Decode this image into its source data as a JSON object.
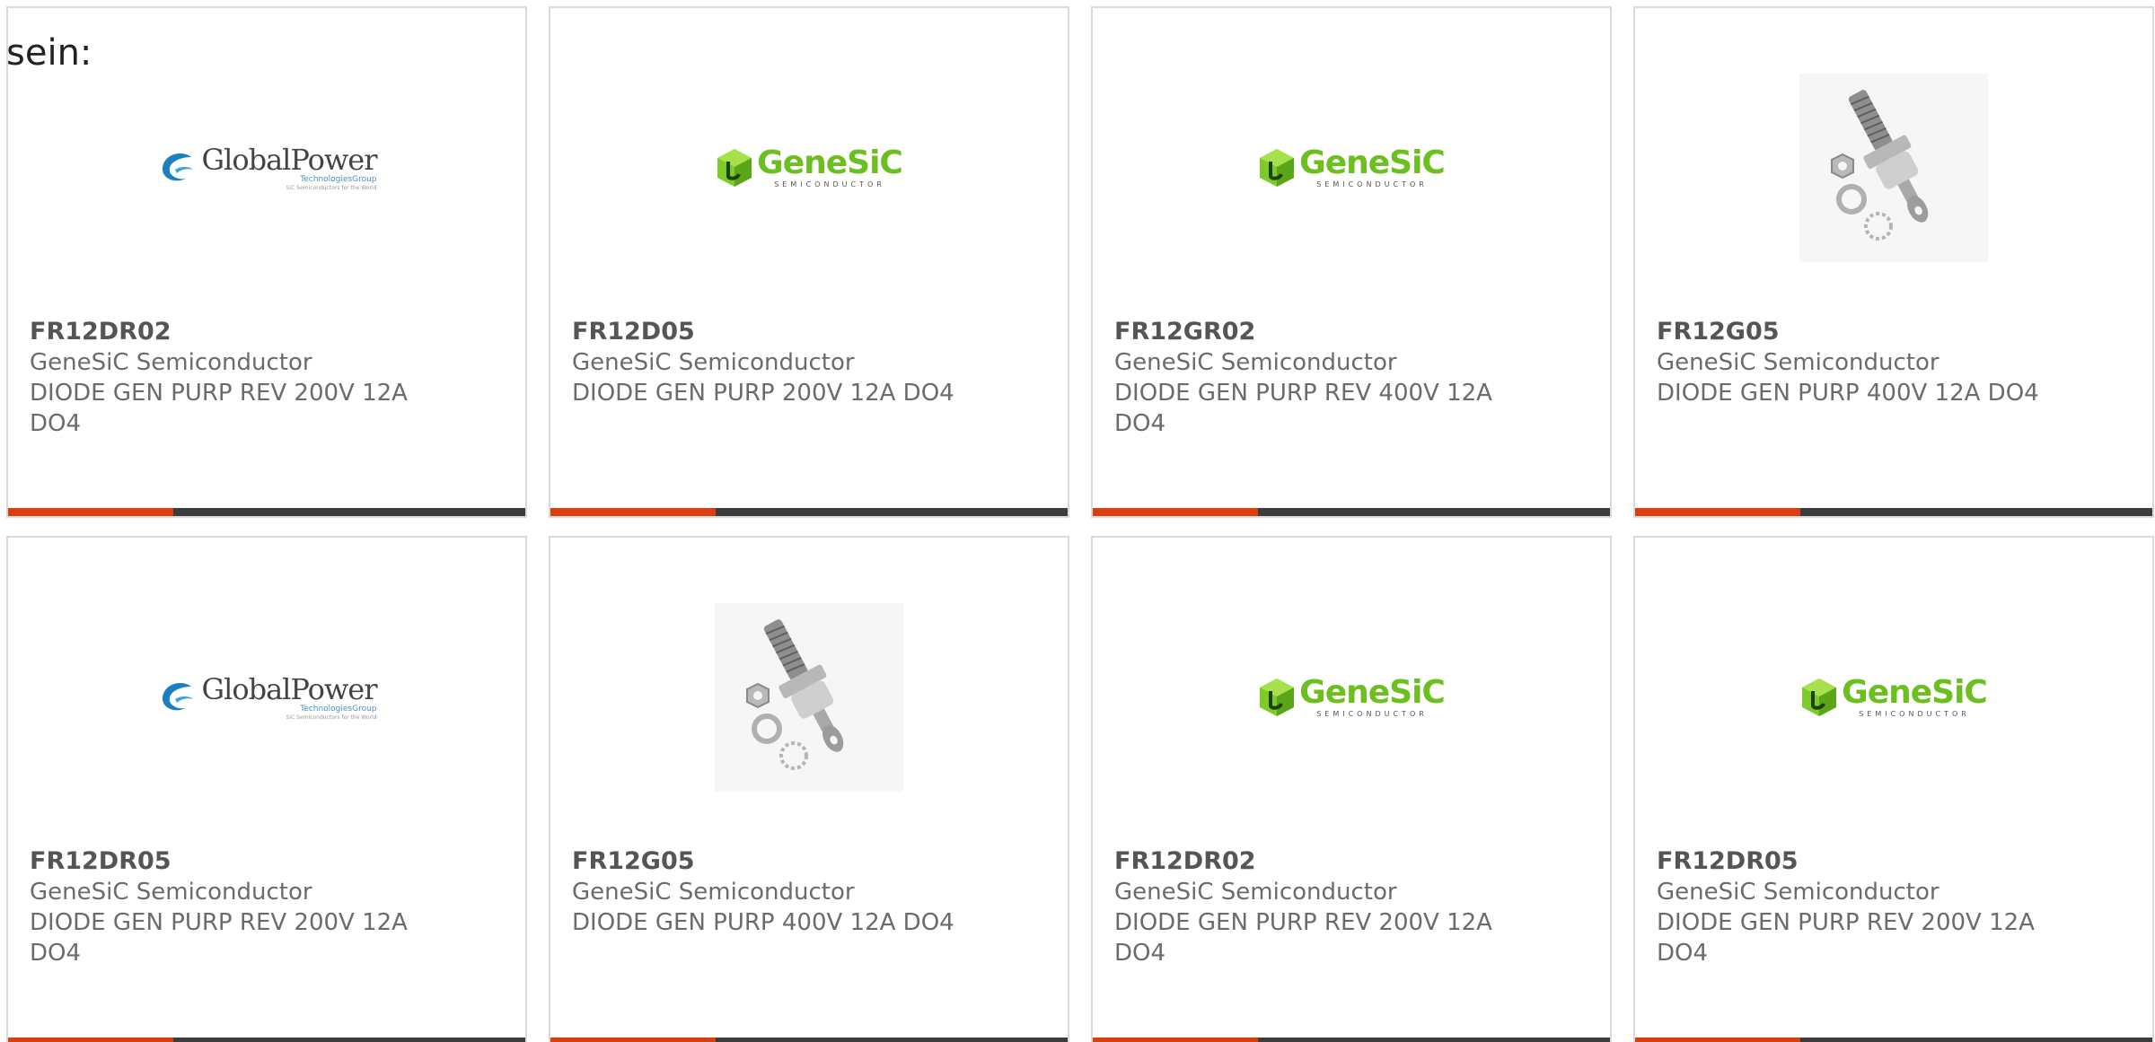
{
  "intro_text": "sein:",
  "colors": {
    "bar_accent": "#d9400f",
    "bar_rest": "#3c3c3c",
    "card_border": "#dadada",
    "text": "#6b6b6b"
  },
  "cards": [
    {
      "image": "globalpower-logo",
      "logo_text": {
        "name": "GlobalPower",
        "sub": "TechnologiesGroup",
        "tag": "SiC Semiconductors for the World"
      },
      "part_number": "FR12DR02",
      "manufacturer": "GeneSiC Semiconductor",
      "description": "DIODE GEN PURP REV 200V 12A DO4"
    },
    {
      "image": "genesic-logo",
      "logo_text": {
        "name": "GeneSiC",
        "sub": "SEMICONDUCTOR"
      },
      "part_number": "FR12D05",
      "manufacturer": "GeneSiC Semiconductor",
      "description": "DIODE GEN PURP 200V 12A DO4"
    },
    {
      "image": "genesic-logo",
      "logo_text": {
        "name": "GeneSiC",
        "sub": "SEMICONDUCTOR"
      },
      "part_number": "FR12GR02",
      "manufacturer": "GeneSiC Semiconductor",
      "description": "DIODE GEN PURP REV 400V 12A DO4"
    },
    {
      "image": "diode-photo",
      "part_number": "FR12G05",
      "manufacturer": "GeneSiC Semiconductor",
      "description": "DIODE GEN PURP 400V 12A DO4"
    },
    {
      "image": "globalpower-logo",
      "logo_text": {
        "name": "GlobalPower",
        "sub": "TechnologiesGroup",
        "tag": "SiC Semiconductors for the World"
      },
      "part_number": "FR12DR05",
      "manufacturer": "GeneSiC Semiconductor",
      "description": "DIODE GEN PURP REV 200V 12A DO4"
    },
    {
      "image": "diode-photo",
      "part_number": "FR12G05",
      "manufacturer": "GeneSiC Semiconductor",
      "description": "DIODE GEN PURP 400V 12A DO4"
    },
    {
      "image": "genesic-logo",
      "logo_text": {
        "name": "GeneSiC",
        "sub": "SEMICONDUCTOR"
      },
      "part_number": "FR12DR02",
      "manufacturer": "GeneSiC Semiconductor",
      "description": "DIODE GEN PURP REV 200V 12A DO4"
    },
    {
      "image": "genesic-logo",
      "logo_text": {
        "name": "GeneSiC",
        "sub": "SEMICONDUCTOR"
      },
      "part_number": "FR12DR05",
      "manufacturer": "GeneSiC Semiconductor",
      "description": "DIODE GEN PURP REV 200V 12A DO4"
    }
  ]
}
